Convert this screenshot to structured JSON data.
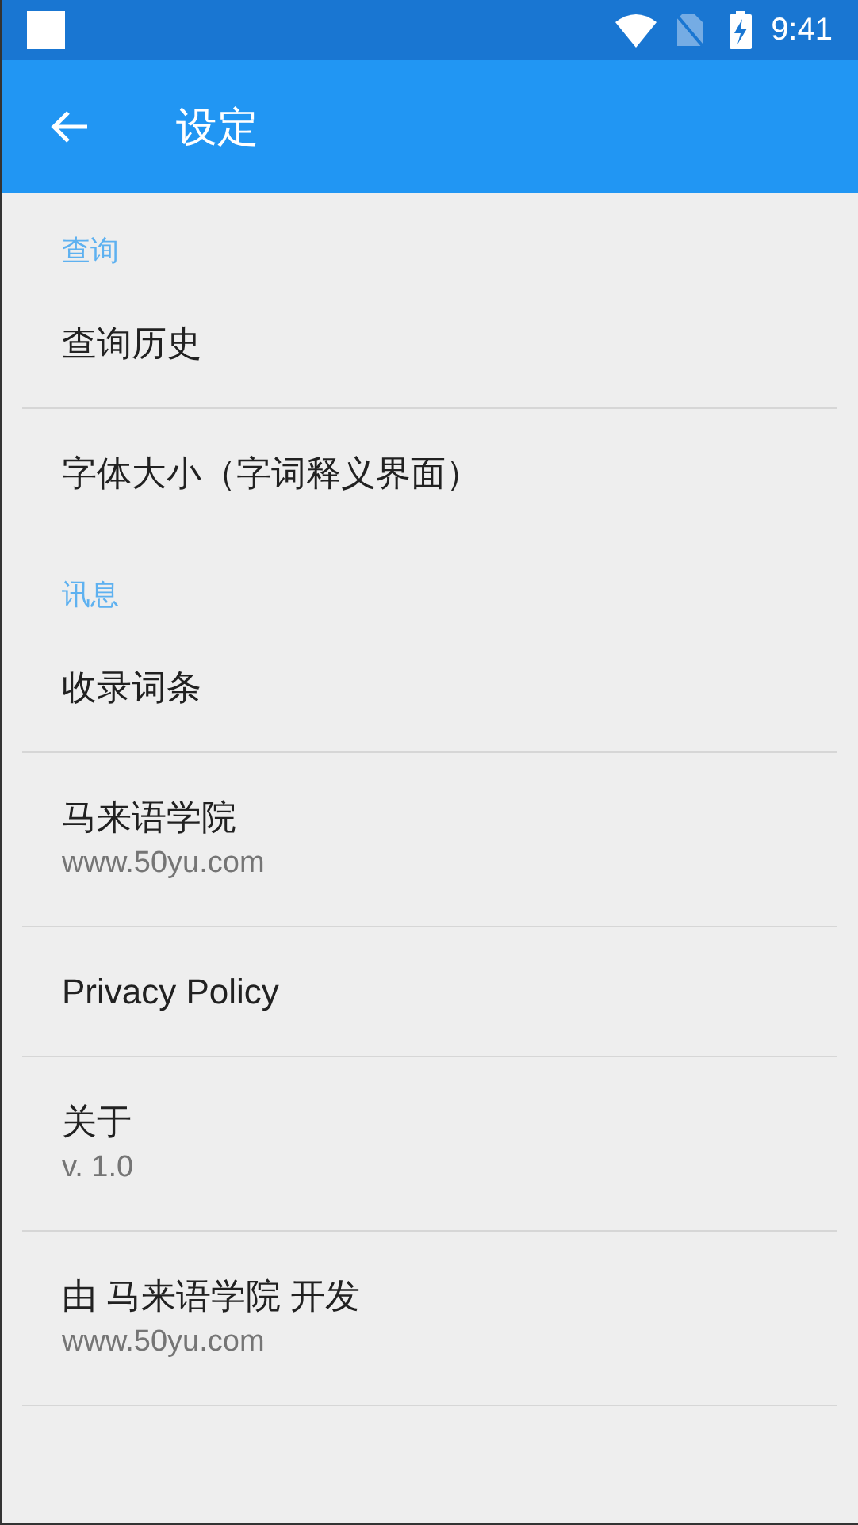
{
  "status_bar": {
    "time": "9:41"
  },
  "app_bar": {
    "title": "设定"
  },
  "sections": [
    {
      "header": "查询",
      "items": [
        {
          "title": "查询历史"
        },
        {
          "title": "字体大小（字词释义界面）"
        }
      ]
    },
    {
      "header": "讯息",
      "items": [
        {
          "title": "收录词条"
        },
        {
          "title": "马来语学院",
          "subtitle": "www.50yu.com"
        },
        {
          "title": "Privacy Policy"
        },
        {
          "title": "关于",
          "subtitle": "v. 1.0"
        },
        {
          "title": "由 马来语学院 开发",
          "subtitle": "www.50yu.com"
        }
      ]
    }
  ]
}
